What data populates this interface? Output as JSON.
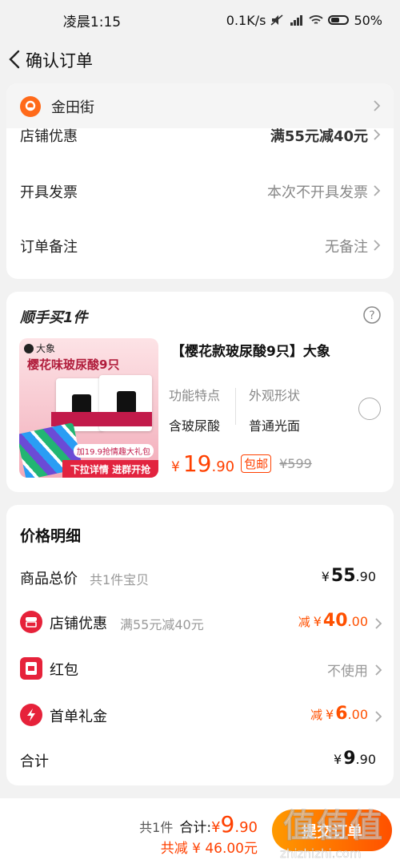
{
  "status_bar": {
    "time": "凌晨1:15",
    "network_speed": "0.1K/s",
    "battery": "50%"
  },
  "nav": {
    "title": "确认订单"
  },
  "address": {
    "text": "金田街"
  },
  "order_rows": [
    {
      "label": "店铺优惠",
      "value": "满55元减40元"
    },
    {
      "label": "开具发票",
      "value": "本次不开具发票"
    },
    {
      "label": "订单备注",
      "value": "无备注"
    }
  ],
  "upsell": {
    "title": "顺手买1件",
    "product_title": "【樱花款玻尿酸9只】大象",
    "image": {
      "brand": "大象",
      "headline": "樱花味玻尿酸9只",
      "gift_tag": "加19.9抢情趣大礼包",
      "banner": "下拉详情 进群开抢"
    },
    "spec1_label": "功能特点",
    "spec1_value": "含玻尿酸",
    "spec2_label": "外观形状",
    "spec2_value": "普通光面",
    "price_yen": "¥",
    "price_int": "19",
    "price_dec": ".90",
    "free_shipping": "包邮",
    "original_price": "¥599"
  },
  "price_detail": {
    "title": "价格明细",
    "goods_total_label": "商品总价",
    "goods_total_sub": "共1件宝贝",
    "goods_total_int": "55",
    "goods_total_dec": ".90",
    "shop_discount_label": "店铺优惠",
    "shop_discount_sub": "满55元减40元",
    "shop_discount_prefix": "减",
    "shop_discount_int": "40",
    "shop_discount_dec": ".00",
    "red_packet_label": "红包",
    "red_packet_value": "不使用",
    "first_order_label": "首单礼金",
    "first_order_prefix": "减",
    "first_order_int": "6",
    "first_order_dec": ".00",
    "sum_label": "合计",
    "sum_int": "9",
    "sum_dec": ".90",
    "yen": "¥"
  },
  "bottom_bar": {
    "count": "共1件",
    "total_label": "合计:",
    "total_yen": "¥",
    "total_int": "9",
    "total_dec": ".90",
    "saved": "共减 ¥ 46.00元",
    "submit_label": "提交订单"
  },
  "watermark": {
    "big": "值值值",
    "small": "zhizhizhi.com"
  },
  "colors": {
    "accent": "#ff4000",
    "red_icon": "#e6223a"
  }
}
